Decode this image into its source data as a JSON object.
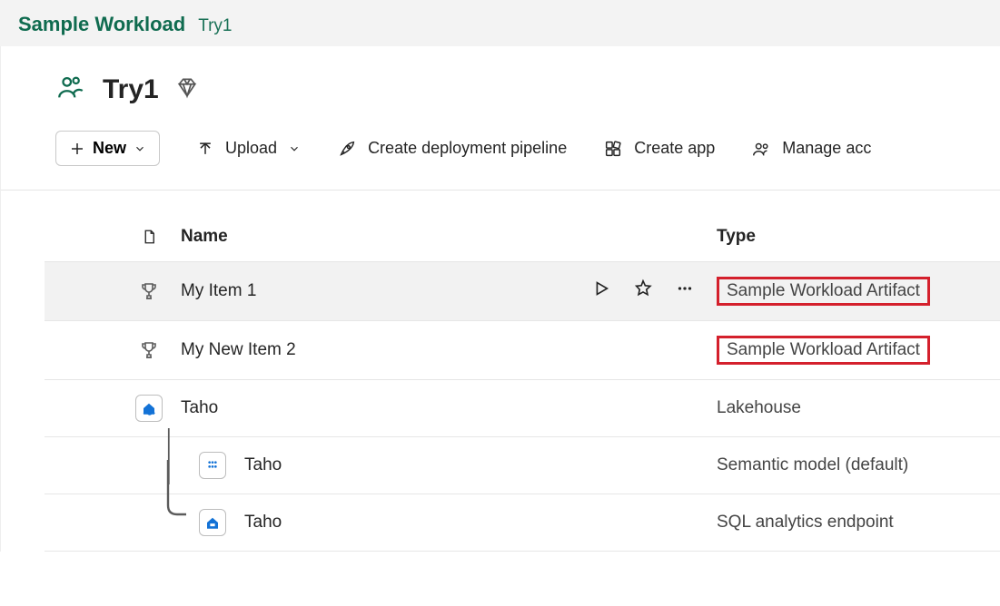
{
  "breadcrumb": {
    "root": "Sample Workload",
    "current": "Try1"
  },
  "workspace": {
    "title": "Try1"
  },
  "toolbar": {
    "new_label": "New",
    "upload_label": "Upload",
    "pipeline_label": "Create deployment pipeline",
    "create_app_label": "Create app",
    "manage_access_label": "Manage acc"
  },
  "table": {
    "headers": {
      "name": "Name",
      "type": "Type"
    },
    "rows": [
      {
        "name": "My Item 1",
        "type": "Sample Workload Artifact",
        "icon": "trophy",
        "highlight": true,
        "hover": true,
        "indent": 0
      },
      {
        "name": "My New Item 2",
        "type": "Sample Workload Artifact",
        "icon": "trophy",
        "highlight": true,
        "hover": false,
        "indent": 0
      },
      {
        "name": "Taho",
        "type": "Lakehouse",
        "icon": "lakehouse",
        "highlight": false,
        "hover": false,
        "indent": 0
      },
      {
        "name": "Taho",
        "type": "Semantic model (default)",
        "icon": "dots6",
        "highlight": false,
        "hover": false,
        "indent": 1
      },
      {
        "name": "Taho",
        "type": "SQL analytics endpoint",
        "icon": "sqlhouse",
        "highlight": false,
        "hover": false,
        "indent": 1
      }
    ]
  }
}
